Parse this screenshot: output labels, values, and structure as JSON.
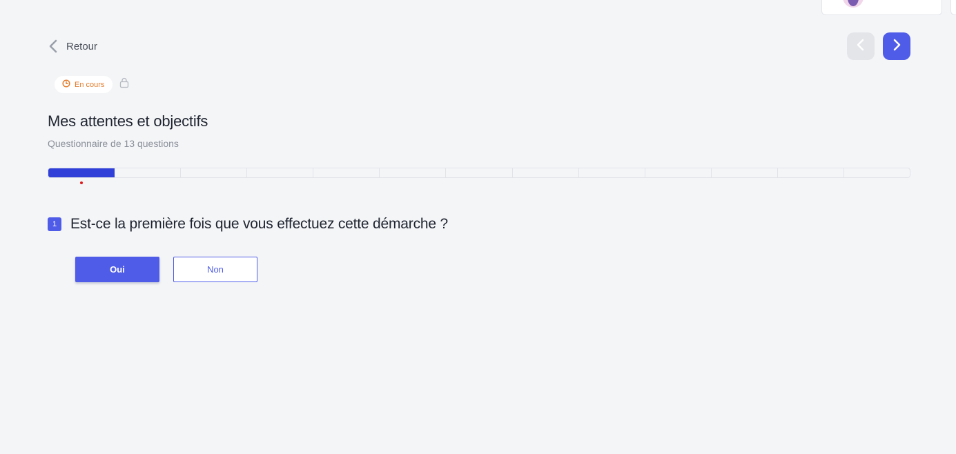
{
  "header": {
    "avatar_icon": "user-avatar"
  },
  "navigation": {
    "back_label": "Retour",
    "back_icon": "chevron-left-icon",
    "prev_icon": "chevron-left-icon",
    "next_icon": "chevron-right-icon"
  },
  "status": {
    "label": "En cours",
    "icon": "clock-icon",
    "lock_icon": "lock-icon",
    "color": "#e47b2a"
  },
  "questionnaire": {
    "title": "Mes attentes et objectifs",
    "subtitle": "Questionnaire de 13 questions",
    "total_questions": 13,
    "current_question": 1,
    "progress_fraction": 0.0769
  },
  "question": {
    "number": "1",
    "text": "Est-ce la première fois que vous effectuez cette démarche ?",
    "answers": [
      {
        "label": "Oui",
        "selected": true
      },
      {
        "label": "Non",
        "selected": false
      }
    ]
  },
  "colors": {
    "accent": "#4f5ce8",
    "progress_fill": "#2f3fd8",
    "background": "#f4f5f7"
  }
}
